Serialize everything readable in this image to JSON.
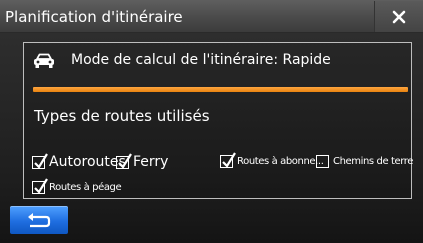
{
  "window": {
    "title": "Planification d'itinéraire",
    "close_icon": "close-icon"
  },
  "mode": {
    "icon": "car-icon",
    "text": "Mode de calcul de l'itinéraire: Rapide"
  },
  "accent_color": "#f08a1c",
  "road_types": {
    "heading": "Types de routes utilisés",
    "options": [
      {
        "label": "Autoroutes",
        "checked": true
      },
      {
        "label": "Ferry",
        "checked": true
      },
      {
        "label": "Routes à abonne...",
        "checked": true
      },
      {
        "label": "Chemins de terre",
        "checked": false
      },
      {
        "label": "Routes à péage",
        "checked": true
      }
    ]
  },
  "back_button": {
    "icon": "back-arrow-icon",
    "color": "#1f6ee0"
  }
}
